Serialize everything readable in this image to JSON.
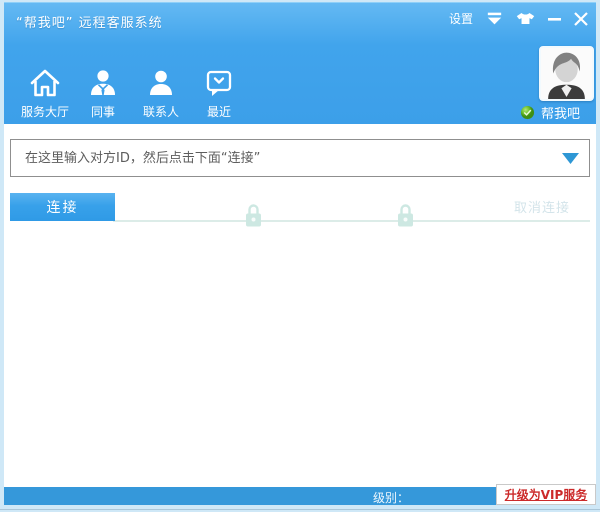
{
  "colors": {
    "header_blue": "#41a4ec",
    "header_blue_light": "#64b9f3",
    "bottom_blue": "#3598da",
    "button_blue": "#38a1ea",
    "frame_blue": "#cfe8f7",
    "lock_teal": "#cde8e2",
    "link_red": "#cc2a2a"
  },
  "titlebar": {
    "title": "“帮我吧” 远程客服系统",
    "settings_label": "设置",
    "icons": [
      "menu-dropdown-icon",
      "skin-icon",
      "minimize-icon",
      "close-icon"
    ]
  },
  "toolbar": {
    "items": [
      {
        "label": "服务大厅",
        "icon": "home-icon"
      },
      {
        "label": "同事",
        "icon": "colleagues-icon"
      },
      {
        "label": "联系人",
        "icon": "contact-icon"
      },
      {
        "label": "最近",
        "icon": "recent-icon"
      }
    ]
  },
  "user": {
    "name": "帮我吧",
    "status_icon": "online-status-icon"
  },
  "connect": {
    "placeholder": "在这里输入对方ID，然后点击下面“连接”",
    "connect_label": "连接",
    "cancel_label": "取消连接",
    "lock_icon_count": 2
  },
  "statusbar": {
    "level_label": "级别：",
    "vip_link_label": "升级为VIP服务"
  }
}
